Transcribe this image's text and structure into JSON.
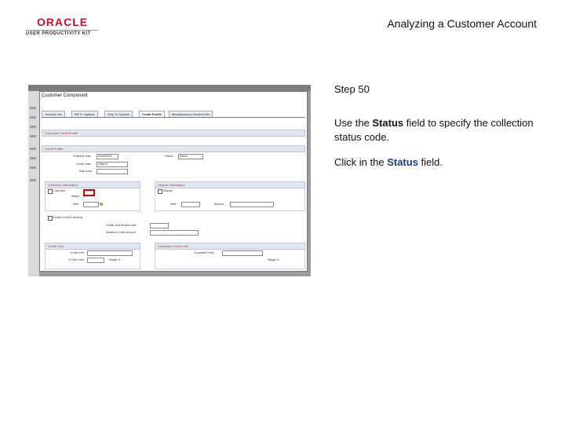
{
  "logo": {
    "brand": "ORACLE",
    "subtitle": "USER PRODUCTIVITY KIT"
  },
  "document_title": "Analyzing a Customer Account",
  "step": {
    "label": "Step 50"
  },
  "instruction": {
    "before": "Use the ",
    "keyword": "Status",
    "after": " field to specify the collection status code."
  },
  "action": {
    "before": "Click in the ",
    "keyword": "Status",
    "after": " field."
  },
  "screenshot": {
    "window_title": "Customer Component",
    "tabs": [
      "General Info",
      "Bill To Options",
      "Ship To Options",
      "Credit Profile",
      "Miscellaneous General Info"
    ],
    "active_tab": "Credit Profile",
    "sections": [
      "Corporate Credit Profile",
      "Credit Profile",
      "Collection Information",
      "Dispute Information",
      "Credit Limit",
      "Corporate Credit Limit"
    ],
    "labels": {
      "effective_date": "*Effective Date",
      "effective_date_value": "04/25/2013",
      "status": "*Status",
      "status_value": "Active",
      "credit_class": "Credit Class",
      "credit_class_value": "Class A",
      "risk_code": "Risk Code",
      "collection": "Collection",
      "dispute": "Dispute",
      "status_small": "Status",
      "date": "Date",
      "amount": "Amount",
      "enable_credit_checking": "Enable Credit Checking",
      "credit_limit_review_date": "Credit Limit Review Date",
      "maximum_order_amount": "Maximum Order Amount",
      "credit_limit": "Credit Limit",
      "pct_over_limit": "% Over Limit",
      "corporate_credit": "Corporate Credit",
      "range_pct": "Range %"
    }
  }
}
